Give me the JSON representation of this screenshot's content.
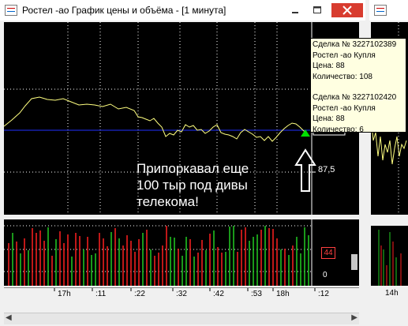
{
  "window": {
    "title": "Ростел -ао График цены и объёма - [1 минута]"
  },
  "price_chart": {
    "y_label": "87,5",
    "annotation_lines": [
      "Припоркавал еще",
      "100 тыр под дивы",
      "телекома!"
    ]
  },
  "tooltip": {
    "deal1": {
      "id": "Сделка № 3227102389",
      "instrument": "Ростел -ао Купля",
      "price": "Цена: 88",
      "qty": "Количество: 108"
    },
    "deal2": {
      "id": "Сделка № 3227102420",
      "instrument": "Ростел -ао Купля",
      "price": "Цена: 88",
      "qty": "Количество: 6"
    }
  },
  "volume_chart": {
    "badge": "44",
    "zero_label": "0"
  },
  "time_axis": {
    "ticks": [
      "17h",
      ":11",
      ":22",
      ":32",
      ":42",
      ":53",
      "18h",
      ":12"
    ]
  },
  "side_window": {
    "tick": "14h"
  },
  "colors": {
    "buy": "#22cc22",
    "sell": "#ff2020",
    "line": "#ffff80",
    "level": "#2030ff"
  }
}
